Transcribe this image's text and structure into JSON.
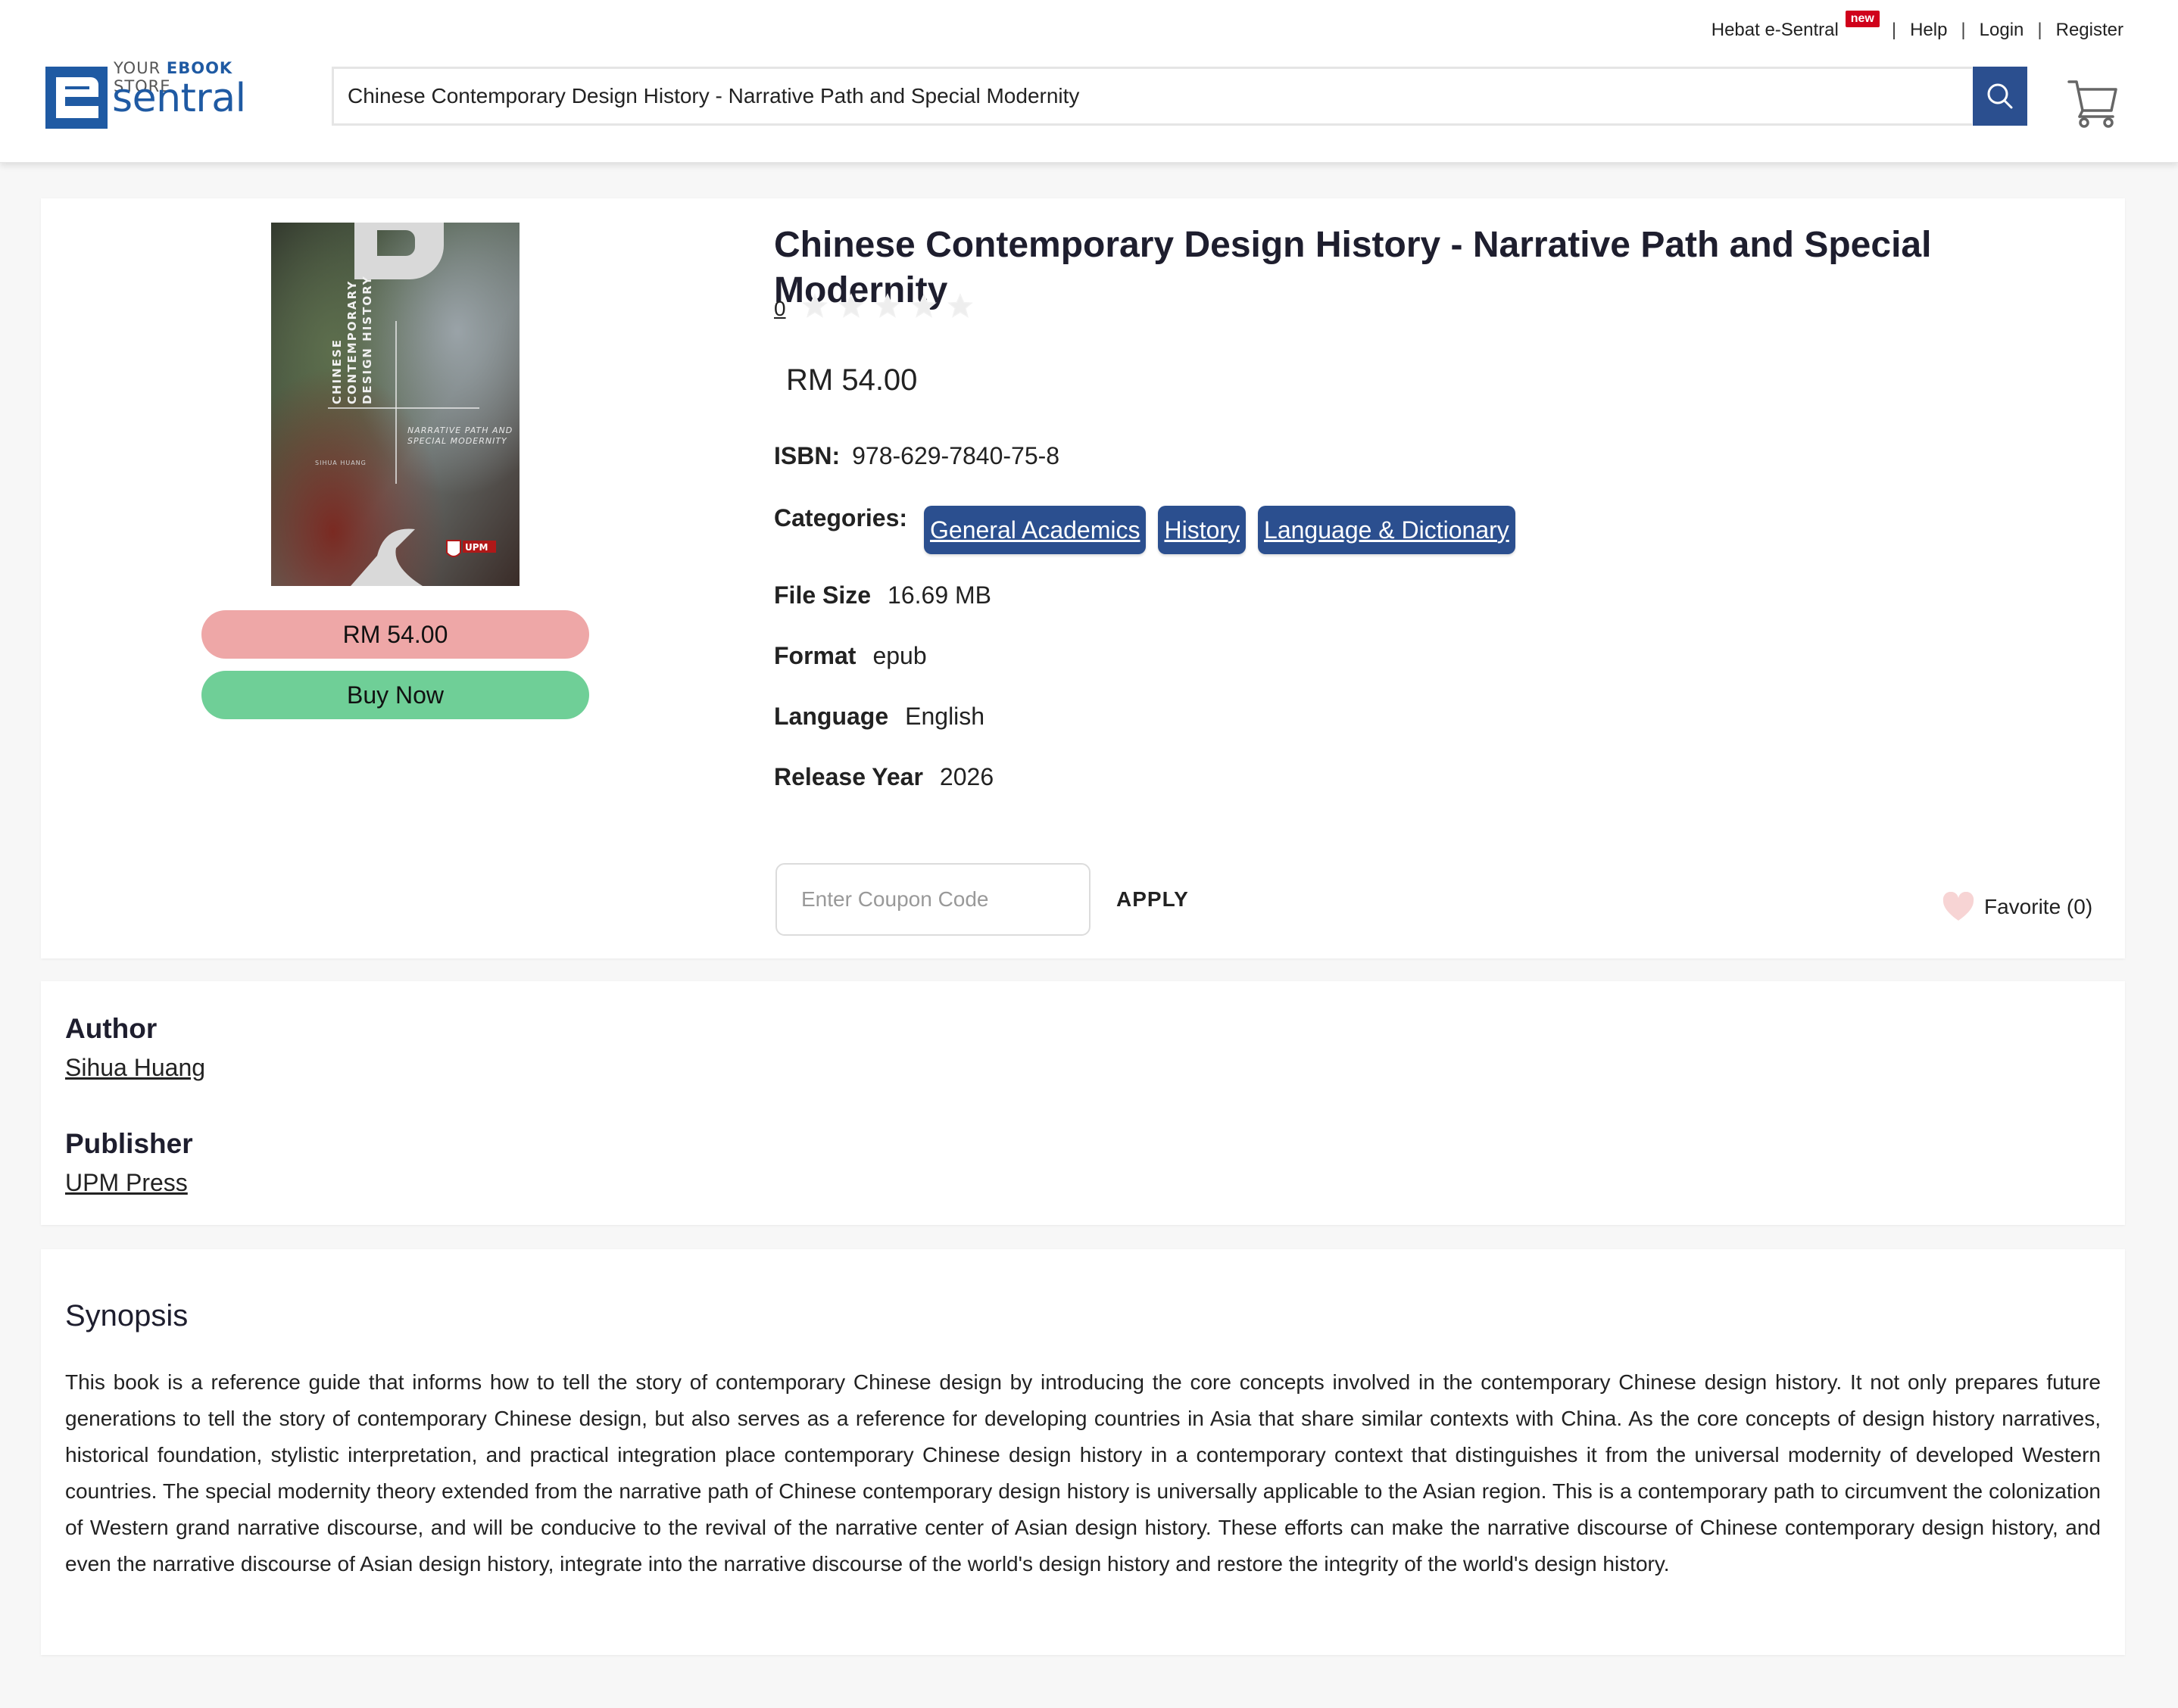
{
  "header": {
    "top_links": {
      "hebat": "Hebat e-Sentral",
      "new_badge": "new",
      "help": "Help",
      "login": "Login",
      "register": "Register",
      "separator": "|"
    },
    "logo": {
      "tagline_prefix": "YOUR",
      "tagline_bold": "EBOOK",
      "tagline_suffix": "STORE",
      "brand": "sentral"
    },
    "search": {
      "value": "Chinese Contemporary Design History - Narrative Path and Special Modernity",
      "icon": "search-icon"
    },
    "cart_icon": "cart-icon",
    "accent_color": "#2b4f8f"
  },
  "product": {
    "title": "Chinese Contemporary Design History - Narrative Path and Special Modernity",
    "rating_count": "0",
    "rating_stars": 0,
    "rating_max": 5,
    "side_price": "RM 54.00",
    "buy_label": "Buy Now",
    "price": "RM 54.00",
    "isbn_label": "ISBN:",
    "isbn": "978-629-7840-75-8",
    "categories_label": "Categories:",
    "categories": [
      "General Academics",
      "History",
      "Language & Dictionary"
    ],
    "file_size_label": "File Size",
    "file_size": "16.69 MB",
    "format_label": "Format",
    "format": "epub",
    "language_label": "Language",
    "language": "English",
    "release_year_label": "Release Year",
    "release_year": "2026",
    "coupon_placeholder": "Enter Coupon Code",
    "apply_label": "APPLY",
    "favorite_label": "Favorite (0)",
    "cover": {
      "title_lines": [
        "CHINESE",
        "CONTEMPORARY",
        "DESIGN HISTORY"
      ],
      "subtitle_lines": [
        "NARRATIVE PATH AND",
        "SPECIAL MODERNITY"
      ],
      "author": "SIHUA HUANG",
      "publisher_mark": "UPM"
    },
    "colors": {
      "price_pill": "#eea7a7",
      "buy_button": "#6fcf97",
      "category_tag": "#2b4f8f"
    }
  },
  "people": {
    "author_label": "Author",
    "author": "Sihua Huang",
    "publisher_label": "Publisher",
    "publisher": "UPM Press"
  },
  "synopsis": {
    "title": "Synopsis",
    "text": "This book is a reference guide that informs how to tell the story of contemporary Chinese design by introducing the core concepts involved in the contemporary Chinese design history. It not only prepares future generations to tell the story of contemporary Chinese design, but also serves as a reference for developing countries in Asia that share similar contexts with China. As the core concepts of design history narratives, historical foundation, stylistic interpretation, and practical integration place contemporary Chinese design history in a contemporary context that distinguishes it from the universal modernity of developed Western countries. The special modernity theory extended from the narrative path of Chinese contemporary design history is universally applicable to the Asian region. This is a contemporary path to circumvent the colonization of Western grand narrative discourse, and will be conducive to the revival of the narrative center of Asian design history. These efforts can make the narrative discourse of Chinese contemporary design history, and even the narrative discourse of Asian design history, integrate into the narrative discourse of the world's design history and restore the integrity of the world's design history."
  }
}
